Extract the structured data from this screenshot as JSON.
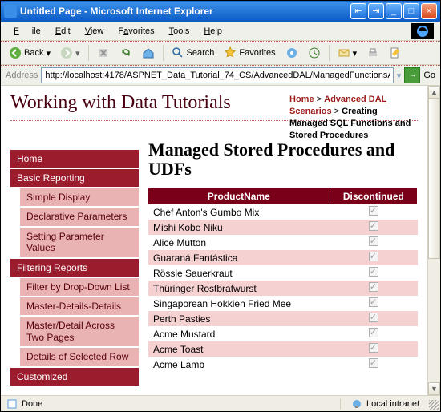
{
  "window": {
    "title": "Untitled Page - Microsoft Internet Explorer"
  },
  "menu": {
    "file": "File",
    "edit": "Edit",
    "view": "View",
    "favorites": "Favorites",
    "tools": "Tools",
    "help": "Help"
  },
  "toolbar": {
    "back": "Back",
    "search": "Search",
    "favorites": "Favorites"
  },
  "address": {
    "label": "Address",
    "url": "http://localhost:4178/ASPNET_Data_Tutorial_74_CS/AdvancedDAL/ManagedFunctionsAndSprocs.aspx",
    "go": "Go"
  },
  "page": {
    "title": "Working with Data Tutorials",
    "breadcrumb": {
      "home": "Home",
      "sep": ">",
      "section": "Advanced DAL Scenarios",
      "tail": "Creating Managed SQL Functions and Stored Procedures"
    },
    "heading": "Managed Stored Procedures and UDFs"
  },
  "sidebar": {
    "home": "Home",
    "basic_reporting": "Basic Reporting",
    "items1": [
      "Simple Display",
      "Declarative Parameters",
      "Setting Parameter Values"
    ],
    "filtering": "Filtering Reports",
    "items2": [
      "Filter by Drop-Down List",
      "Master-Details-Details",
      "Master/Detail Across Two Pages",
      "Details of Selected Row"
    ],
    "customized": "Customized"
  },
  "table": {
    "cols": [
      "ProductName",
      "Discontinued"
    ],
    "rows": [
      {
        "name": "Chef Anton's Gumbo Mix",
        "disc": true
      },
      {
        "name": "Mishi Kobe Niku",
        "disc": true
      },
      {
        "name": "Alice Mutton",
        "disc": true
      },
      {
        "name": "Guaraná Fantástica",
        "disc": true
      },
      {
        "name": "Rössle Sauerkraut",
        "disc": true
      },
      {
        "name": "Thüringer Rostbratwurst",
        "disc": true
      },
      {
        "name": "Singaporean Hokkien Fried Mee",
        "disc": true
      },
      {
        "name": "Perth Pasties",
        "disc": true
      },
      {
        "name": "Acme Mustard",
        "disc": true
      },
      {
        "name": "Acme Toast",
        "disc": true
      },
      {
        "name": "Acme Lamb",
        "disc": true
      }
    ]
  },
  "status": {
    "left": "Done",
    "right": "Local intranet"
  }
}
